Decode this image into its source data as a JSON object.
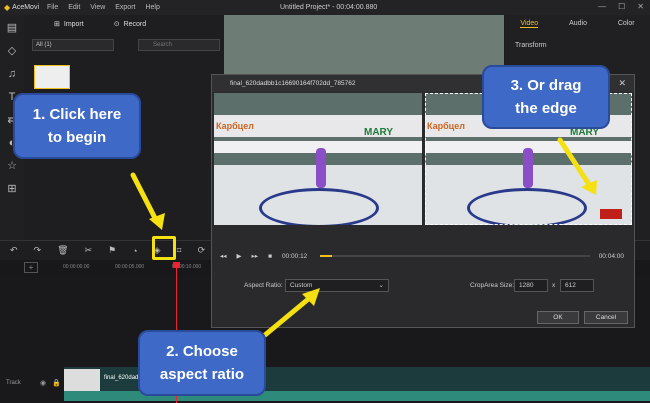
{
  "app": {
    "name": "AceMovi",
    "menu": [
      "File",
      "Edit",
      "View",
      "Export",
      "Help"
    ],
    "project_title": "Untitled Project* - 00:04:00.880"
  },
  "media": {
    "import_label": "Import",
    "record_label": "Record",
    "filter_value": "All (1)",
    "search_placeholder": "Search"
  },
  "right_panel": {
    "tabs": [
      "Video",
      "Audio",
      "Color"
    ],
    "active_tab": "Video",
    "section": "Transform"
  },
  "timeline": {
    "ruler_times": [
      "00:00:00.00",
      "00:00:05.000",
      "00:00:10.000"
    ],
    "track_label": "Track",
    "clip_name": "final_620dadbb..."
  },
  "dialog": {
    "title": "final_620dadbb1c16690164f702dd_785762",
    "close_icon": "close-icon",
    "current_time": "00:00:12",
    "end_time": "00:04:00",
    "aspect_label": "Aspect Ratio:",
    "aspect_value": "Custom",
    "croparea_label": "CropArea Size:",
    "crop_width": "1280",
    "crop_x": "x",
    "crop_height": "612",
    "ok_label": "OK",
    "cancel_label": "Cancel",
    "video_banner": "MARY",
    "video_banner_red": "Карбцел"
  },
  "callouts": {
    "step1_line1": "1.  Click here",
    "step1_line2": "to begin",
    "step2_line1": "2.  Choose",
    "step2_line2": "aspect ratio",
    "step3_line1": "3.  Or drag",
    "step3_line2": "the edge"
  },
  "colors": {
    "accent": "#f0c020",
    "callout_bg": "#3f69c6",
    "arrow": "#f5e011"
  }
}
